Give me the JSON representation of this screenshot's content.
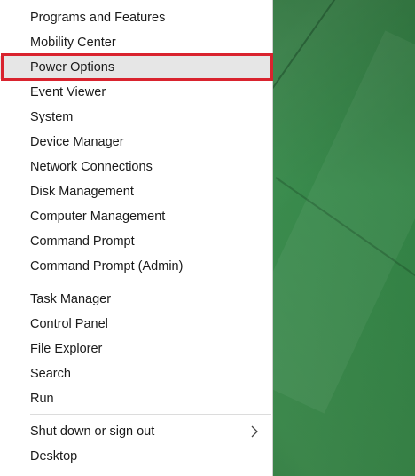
{
  "menu": {
    "group1": [
      {
        "label": "Programs and Features"
      },
      {
        "label": "Mobility Center"
      },
      {
        "label": "Power Options"
      },
      {
        "label": "Event Viewer"
      },
      {
        "label": "System"
      },
      {
        "label": "Device Manager"
      },
      {
        "label": "Network Connections"
      },
      {
        "label": "Disk Management"
      },
      {
        "label": "Computer Management"
      },
      {
        "label": "Command Prompt"
      },
      {
        "label": "Command Prompt (Admin)"
      }
    ],
    "group2": [
      {
        "label": "Task Manager"
      },
      {
        "label": "Control Panel"
      },
      {
        "label": "File Explorer"
      },
      {
        "label": "Search"
      },
      {
        "label": "Run"
      }
    ],
    "group3": [
      {
        "label": "Shut down or sign out",
        "submenu_icon": "chevron-right-icon"
      },
      {
        "label": "Desktop"
      }
    ]
  },
  "colors": {
    "highlight_border": "#d9232e",
    "hover_background": "#e6e6e6",
    "menu_background": "#ffffff",
    "desktop_green": "#2f7a3f"
  }
}
